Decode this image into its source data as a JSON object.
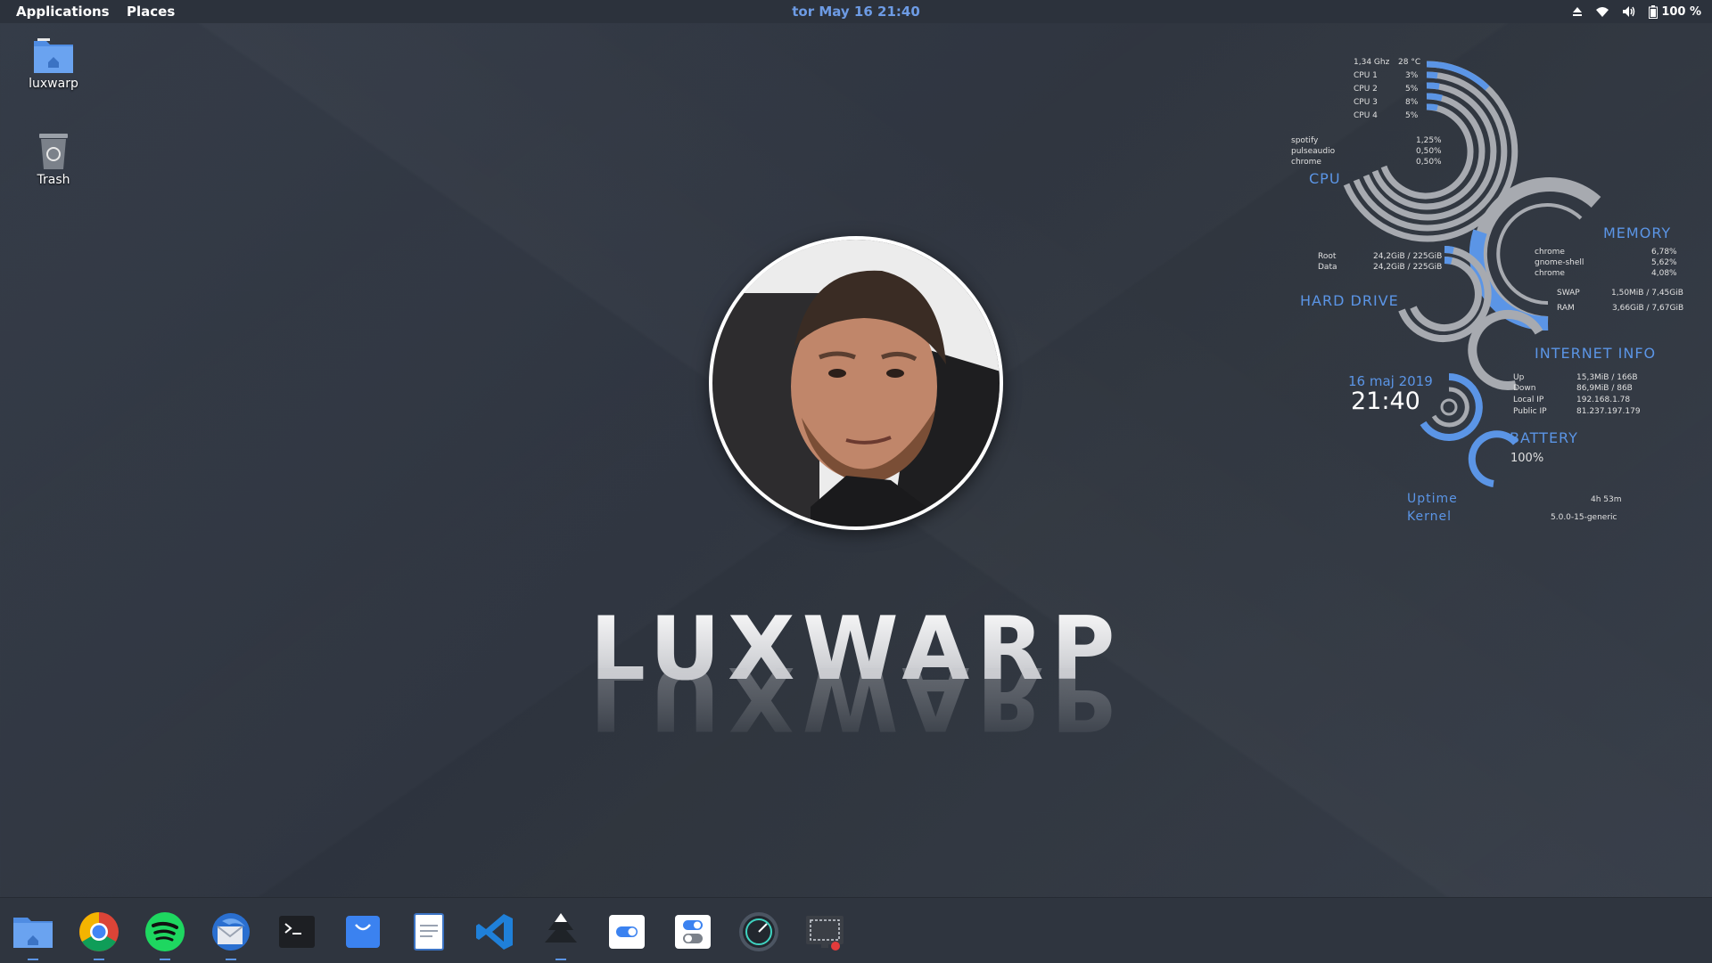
{
  "topbar": {
    "applications": "Applications",
    "places": "Places",
    "clock": "tor May 16 21:40",
    "battery": "100 %"
  },
  "desktop": {
    "icons": [
      {
        "label": "luxwarp",
        "icon": "home-folder-icon"
      },
      {
        "label": "Trash",
        "icon": "trash-icon"
      }
    ]
  },
  "brand": {
    "text": "LUXWARP"
  },
  "conky": {
    "cpu": {
      "heading": "CPU",
      "freq": "1,34 Ghz",
      "temp": "28 °C",
      "cores": [
        {
          "label": "CPU 1",
          "value": "3%"
        },
        {
          "label": "CPU 2",
          "value": "5%"
        },
        {
          "label": "CPU 3",
          "value": "8%"
        },
        {
          "label": "CPU 4",
          "value": "5%"
        }
      ],
      "processes": [
        {
          "name": "spotify",
          "value": "1,25%"
        },
        {
          "name": "pulseaudio",
          "value": "0,50%"
        },
        {
          "name": "chrome",
          "value": "0,50%"
        }
      ]
    },
    "memory": {
      "heading": "MEMORY",
      "processes": [
        {
          "name": "chrome",
          "value": "6,78%"
        },
        {
          "name": "gnome-shell",
          "value": "5,62%"
        },
        {
          "name": "chrome",
          "value": "4,08%"
        }
      ],
      "swap_label": "SWAP",
      "swap": "1,50MiB / 7,45GiB",
      "ram_label": "RAM",
      "ram": "3,66GiB / 7,67GiB"
    },
    "hard_drive": {
      "heading": "HARD DRIVE",
      "rows": [
        {
          "label": "Root",
          "value": "24,2GiB / 225GiB"
        },
        {
          "label": "Data",
          "value": "24,2GiB / 225GiB"
        }
      ]
    },
    "internet": {
      "heading": "INTERNET INFO",
      "rows": [
        {
          "label": "Up",
          "value": "15,3MiB / 166B"
        },
        {
          "label": "Down",
          "value": "86,9MiB / 86B"
        },
        {
          "label": "Local IP",
          "value": "192.168.1.78"
        },
        {
          "label": "Public IP",
          "value": "81.237.197.179"
        }
      ]
    },
    "datetime": {
      "date": "16 maj 2019",
      "time": "21:40"
    },
    "battery": {
      "heading": "BATTERY",
      "value": "100%"
    },
    "uptime": {
      "label": "Uptime",
      "value": "4h 53m"
    },
    "kernel": {
      "label": "Kernel",
      "value": "5.0.0-15-generic"
    }
  },
  "dock": {
    "items": [
      {
        "name": "files",
        "icon": "files-icon",
        "running": true
      },
      {
        "name": "chrome",
        "icon": "chrome-icon",
        "running": true
      },
      {
        "name": "spotify",
        "icon": "spotify-icon",
        "running": true
      },
      {
        "name": "thunderbird",
        "icon": "thunderbird-icon",
        "running": true
      },
      {
        "name": "terminal",
        "icon": "terminal-icon",
        "running": false
      },
      {
        "name": "store",
        "icon": "store-icon",
        "running": false
      },
      {
        "name": "text-editor",
        "icon": "text-editor-icon",
        "running": false
      },
      {
        "name": "vscode",
        "icon": "vscode-icon",
        "running": false
      },
      {
        "name": "inkscape",
        "icon": "inkscape-icon",
        "running": true
      },
      {
        "name": "tweaks",
        "icon": "toggle-icon",
        "running": false
      },
      {
        "name": "settings",
        "icon": "switches-icon",
        "running": false
      },
      {
        "name": "stacer",
        "icon": "stacer-icon",
        "running": false
      },
      {
        "name": "screenshot",
        "icon": "screenshot-icon",
        "running": false
      }
    ]
  },
  "colors": {
    "accent": "#5b95e6",
    "panel": "#2c323c",
    "desktop": "#323943"
  }
}
